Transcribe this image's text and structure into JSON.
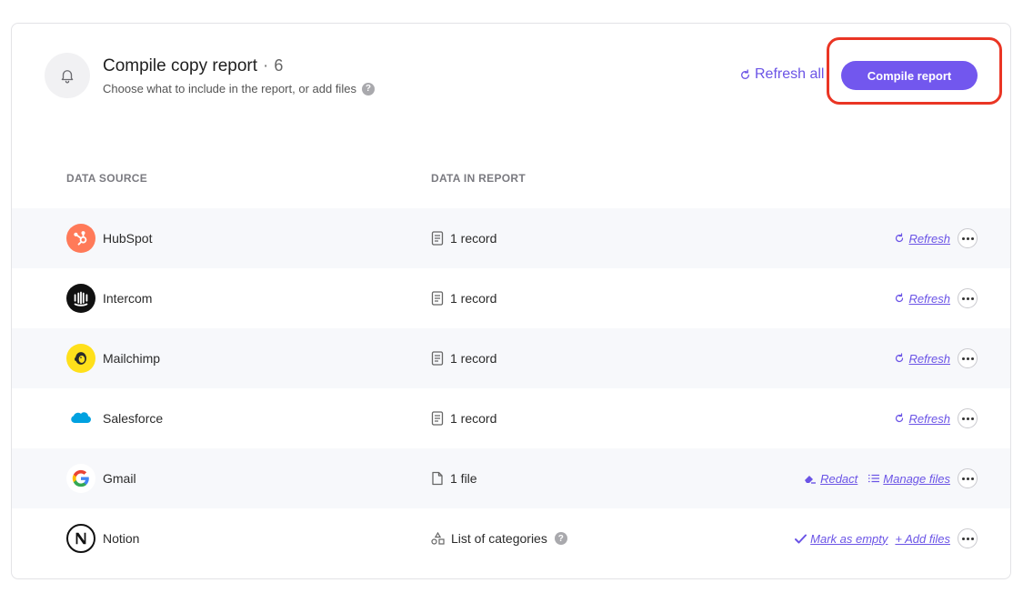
{
  "header": {
    "title": "Compile copy report",
    "separator": "·",
    "count": "6",
    "subtitle": "Choose what to include in the report, or add files",
    "help_glyph": "?",
    "refresh_all_label": "Refresh all",
    "compile_label": "Compile report"
  },
  "table": {
    "columns": [
      "DATA SOURCE",
      "DATA IN REPORT"
    ],
    "rows": [
      {
        "name": "HubSpot",
        "data": "1 record",
        "data_icon": "document-icon",
        "actions": [
          "Refresh"
        ]
      },
      {
        "name": "Intercom",
        "data": "1 record",
        "data_icon": "document-icon",
        "actions": [
          "Refresh"
        ]
      },
      {
        "name": "Mailchimp",
        "data": "1 record",
        "data_icon": "document-icon",
        "actions": [
          "Refresh"
        ]
      },
      {
        "name": "Salesforce",
        "data": "1 record",
        "data_icon": "document-icon",
        "actions": [
          "Refresh"
        ]
      },
      {
        "name": "Gmail",
        "data": "1 file",
        "data_icon": "file-icon",
        "actions": [
          "Redact",
          "Manage files"
        ]
      },
      {
        "name": "Notion",
        "data": "List of categories",
        "data_icon": "categories-icon",
        "actions": [
          "Mark as empty",
          "+ Add files"
        ]
      }
    ]
  },
  "colors": {
    "accent": "#7257ee",
    "link": "#6b54e6",
    "highlight": "#ea3524",
    "row_shade": "#f7f8fb",
    "hubspot": "#ff7a59",
    "mailchimp": "#ffe01b",
    "salesforce": "#00a1e0"
  }
}
